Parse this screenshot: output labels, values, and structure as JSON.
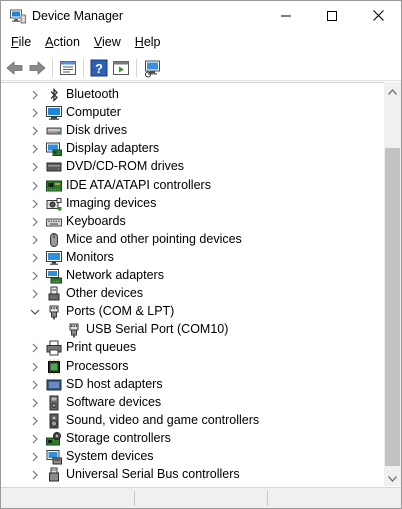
{
  "window": {
    "title": "Device Manager",
    "icon": "computer-device-icon"
  },
  "menu": [
    {
      "label": "File",
      "access": "F",
      "rest": "ile"
    },
    {
      "label": "Action",
      "access": "A",
      "rest": "ction"
    },
    {
      "label": "View",
      "access": "V",
      "rest": "iew"
    },
    {
      "label": "Help",
      "access": "H",
      "rest": "elp"
    }
  ],
  "toolbar": {
    "buttons": [
      "back-arrow-icon",
      "forward-arrow-icon",
      "properties-icon",
      "help-icon",
      "run-icon",
      "scan-hardware-icon"
    ]
  },
  "tree": {
    "nodes": [
      {
        "label": "Bluetooth",
        "icon": "bluetooth-icon",
        "expanded": false,
        "level": 0
      },
      {
        "label": "Computer",
        "icon": "computer-icon",
        "expanded": false,
        "level": 0
      },
      {
        "label": "Disk drives",
        "icon": "disk-drive-icon",
        "expanded": false,
        "level": 0
      },
      {
        "label": "Display adapters",
        "icon": "display-adapter-icon",
        "expanded": false,
        "level": 0
      },
      {
        "label": "DVD/CD-ROM drives",
        "icon": "dvd-drive-icon",
        "expanded": false,
        "level": 0
      },
      {
        "label": "IDE ATA/ATAPI controllers",
        "icon": "ide-controller-icon",
        "expanded": false,
        "level": 0
      },
      {
        "label": "Imaging devices",
        "icon": "camera-icon",
        "expanded": false,
        "level": 0
      },
      {
        "label": "Keyboards",
        "icon": "keyboard-icon",
        "expanded": false,
        "level": 0
      },
      {
        "label": "Mice and other pointing devices",
        "icon": "mouse-icon",
        "expanded": false,
        "level": 0
      },
      {
        "label": "Monitors",
        "icon": "monitor-icon",
        "expanded": false,
        "level": 0
      },
      {
        "label": "Network adapters",
        "icon": "network-adapter-icon",
        "expanded": false,
        "level": 0
      },
      {
        "label": "Other devices",
        "icon": "other-device-icon",
        "expanded": false,
        "level": 0
      },
      {
        "label": "Ports (COM & LPT)",
        "icon": "port-icon",
        "expanded": true,
        "level": 0
      },
      {
        "label": "USB Serial Port (COM10)",
        "icon": "port-icon",
        "expanded": null,
        "level": 1
      },
      {
        "label": "Print queues",
        "icon": "printer-icon",
        "expanded": false,
        "level": 0
      },
      {
        "label": "Processors",
        "icon": "processor-icon",
        "expanded": false,
        "level": 0
      },
      {
        "label": "SD host adapters",
        "icon": "sd-card-icon",
        "expanded": false,
        "level": 0
      },
      {
        "label": "Software devices",
        "icon": "software-device-icon",
        "expanded": false,
        "level": 0
      },
      {
        "label": "Sound, video and game controllers",
        "icon": "speaker-icon",
        "expanded": false,
        "level": 0
      },
      {
        "label": "Storage controllers",
        "icon": "storage-controller-icon",
        "expanded": false,
        "level": 0
      },
      {
        "label": "System devices",
        "icon": "system-device-icon",
        "expanded": false,
        "level": 0
      },
      {
        "label": "Universal Serial Bus controllers",
        "icon": "usb-icon",
        "expanded": false,
        "level": 0
      }
    ]
  },
  "colors": {
    "accent": "#0078d7",
    "scroll_thumb": "#c2c2c2",
    "status_bg": "#f0f0f0"
  }
}
